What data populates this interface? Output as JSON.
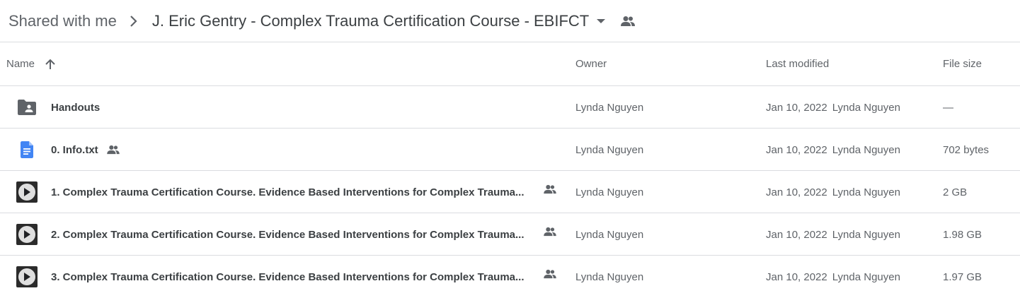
{
  "breadcrumb": {
    "root": "Shared with me",
    "current": "J. Eric Gentry - Complex Trauma Certification Course - EBIFCT"
  },
  "columns": {
    "name": "Name",
    "owner": "Owner",
    "last_modified": "Last modified",
    "file_size": "File size"
  },
  "files": [
    {
      "name": "Handouts",
      "type": "shared-folder",
      "owner": "Lynda Nguyen",
      "date": "Jan 10, 2022",
      "by": "Lynda Nguyen",
      "size": "—"
    },
    {
      "name": "0. Info.txt",
      "type": "doc",
      "owner": "Lynda Nguyen",
      "date": "Jan 10, 2022",
      "by": "Lynda Nguyen",
      "size": "702 bytes"
    },
    {
      "name": "1. Complex Trauma Certification Course.  Evidence Based Interventions for Complex Trauma...",
      "type": "video",
      "owner": "Lynda Nguyen",
      "date": "Jan 10, 2022",
      "by": "Lynda Nguyen",
      "size": "2 GB"
    },
    {
      "name": "2. Complex Trauma Certification Course.  Evidence Based Interventions for Complex Trauma...",
      "type": "video",
      "owner": "Lynda Nguyen",
      "date": "Jan 10, 2022",
      "by": "Lynda Nguyen",
      "size": "1.98 GB"
    },
    {
      "name": "3. Complex Trauma Certification Course.  Evidence Based Interventions for Complex Trauma...",
      "type": "video",
      "owner": "Lynda Nguyen",
      "date": "Jan 10, 2022",
      "by": "Lynda Nguyen",
      "size": "1.97 GB"
    }
  ],
  "colors": {
    "doc_blue": "#4285f4",
    "icon_gray": "#5f6368",
    "divider": "#dadce0"
  }
}
